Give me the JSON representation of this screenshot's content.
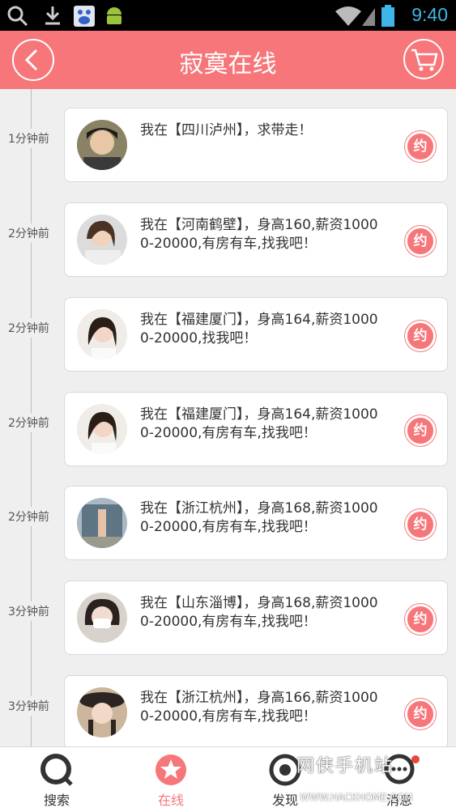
{
  "status_bar": {
    "time": "9:40"
  },
  "header": {
    "title": "寂寞在线"
  },
  "feed": [
    {
      "time": "1分钟前",
      "text": "我在【四川泸州】，求带走！",
      "action": "约"
    },
    {
      "time": "2分钟前",
      "text": "我在【河南鹤壁】，身高160,薪资10000-20000,有房有车,找我吧！",
      "action": "约"
    },
    {
      "time": "2分钟前",
      "text": "我在【福建厦门】，身高164,薪资10000-20000,找我吧！",
      "action": "约"
    },
    {
      "time": "2分钟前",
      "text": "我在【福建厦门】，身高164,薪资10000-20000,有房有车,找我吧！",
      "action": "约"
    },
    {
      "time": "2分钟前",
      "text": "我在【浙江杭州】，身高168,薪资10000-20000,有房有车,找我吧！",
      "action": "约"
    },
    {
      "time": "3分钟前",
      "text": "我在【山东淄博】，身高168,薪资10000-20000,有房有车,找我吧！",
      "action": "约"
    },
    {
      "time": "3分钟前",
      "text": "我在【浙江杭州】，身高166,薪资10000-20000,有房有车,找我吧！",
      "action": "约"
    }
  ],
  "nav": [
    {
      "label": "搜索",
      "icon": "search-icon"
    },
    {
      "label": "在线",
      "icon": "star-icon"
    },
    {
      "label": "发现",
      "icon": "discover-icon"
    },
    {
      "label": "消息",
      "icon": "message-icon"
    }
  ],
  "watermark": {
    "text": "网侠手机站",
    "url": "WWW.HACKHOME.COM"
  },
  "colors": {
    "accent": "#f6767a",
    "status_time": "#3fb6ea"
  }
}
